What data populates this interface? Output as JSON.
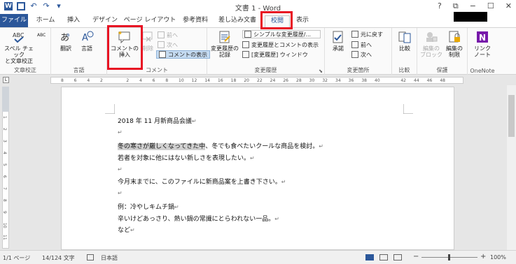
{
  "window": {
    "title": "文書 1 - Word",
    "help": "?",
    "restore": "⧉",
    "minimize": "−",
    "maximize": "☐",
    "close": "✕"
  },
  "qat": {
    "undo": "↶",
    "redo": "↷",
    "more": "▾"
  },
  "tabs": [
    {
      "label": "ファイル"
    },
    {
      "label": "ホーム"
    },
    {
      "label": "挿入"
    },
    {
      "label": "デザイン"
    },
    {
      "label": "ページ レイアウト"
    },
    {
      "label": "参考資料"
    },
    {
      "label": "差し込み文書"
    },
    {
      "label": "校閲"
    },
    {
      "label": "表示"
    }
  ],
  "ribbon": {
    "proofing": {
      "label": "文章校正",
      "spell": "スペル チェック\nと文章校正",
      "abc_small": "ABC"
    },
    "language": {
      "label": "言語",
      "translate": "翻訳",
      "language": "言語"
    },
    "comments": {
      "label": "コメント",
      "new": "コメントの\n挿入",
      "delete": "削除",
      "prev": "前へ",
      "next": "次へ",
      "show": "コメントの表示"
    },
    "tracking": {
      "label": "変更履歴",
      "track": "変更履歴の\n記録",
      "simple": "シンプルな変更履歴/...",
      "showmarkup": "変更履歴とコメントの表示",
      "pane": "[変更履歴] ウィンドウ",
      "launcher": "⬊"
    },
    "changes": {
      "label": "変更箇所",
      "accept": "承諾",
      "reject": "元に戻す",
      "prev": "前へ",
      "next": "次へ"
    },
    "compare": {
      "label": "比較",
      "compare": "比較"
    },
    "protect": {
      "label": "保護",
      "block": "編集の\nブロック",
      "restrict": "編集の\n制限"
    },
    "onenote": {
      "label": "OneNote",
      "link": "リンク\nノート"
    }
  },
  "ruler": {
    "numbers": [
      "8",
      "6",
      "4",
      "2",
      "",
      "2",
      "4",
      "6",
      "8",
      "10",
      "12",
      "14",
      "16",
      "18",
      "20",
      "22",
      "24",
      "26",
      "28",
      "30",
      "32",
      "34",
      "36",
      "38",
      "40",
      "",
      "42",
      "44",
      "46",
      "48"
    ],
    "vnumbers": [
      "1",
      "2",
      "3",
      "4",
      "5",
      "6",
      "7",
      "8",
      "9",
      "10",
      "11"
    ]
  },
  "document": {
    "lines": [
      {
        "text": "2018 年 11 月新商品会議",
        "mark": "↵"
      },
      {
        "text": "",
        "mark": "↵"
      },
      {
        "hl": "冬の寒さが厳しくなってきた中",
        "text": "、冬でも食べたいクールな商品を検討。",
        "mark": "↵"
      },
      {
        "text": "若者を対象に他にはない新しさを表現したい。",
        "mark": "↵"
      },
      {
        "text": "",
        "mark": "↵"
      },
      {
        "text": "今月末までに、このファイルに新商品案を上書き下さい。",
        "mark": "↵"
      },
      {
        "text": "",
        "mark": "↵"
      },
      {
        "text": "例：冷やしキムチ鍋",
        "mark": "↵"
      },
      {
        "text": "辛いけどあっさり、熱い鍋の常識にとらわれない一品。",
        "mark": "↵"
      },
      {
        "text": "など",
        "mark": "↵"
      }
    ]
  },
  "status": {
    "page": "1/1 ページ",
    "words": "14/124 文字",
    "lang": "日本語",
    "zoom": "100%",
    "minus": "−",
    "plus": "+"
  },
  "colors": {
    "accent": "#2b579a",
    "highlight_box": "#e81123",
    "onenote": "#7719aa"
  }
}
